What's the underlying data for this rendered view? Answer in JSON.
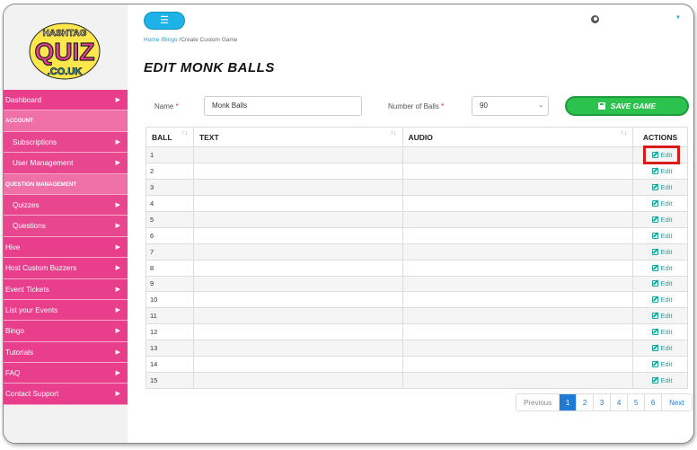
{
  "logo": {
    "line1": "HASHTAG",
    "line2": "QUIZ",
    "line3": ".CO.UK"
  },
  "sidebar": {
    "items": [
      {
        "label": "Dashboard",
        "kind": "top",
        "chevron": true
      },
      {
        "label": "ACCOUNT",
        "kind": "section",
        "chevron": false
      },
      {
        "label": "Subscriptions",
        "kind": "sub",
        "chevron": true
      },
      {
        "label": "User Management",
        "kind": "sub",
        "chevron": true
      },
      {
        "label": "QUESTION MANAGEMENT",
        "kind": "section",
        "chevron": false
      },
      {
        "label": "Quizzes",
        "kind": "sub",
        "chevron": true
      },
      {
        "label": "Questions",
        "kind": "sub",
        "chevron": true
      },
      {
        "label": "Hive",
        "kind": "top",
        "chevron": true
      },
      {
        "label": "Host Custom Buzzers",
        "kind": "top",
        "chevron": true
      },
      {
        "label": "Event Tickets",
        "kind": "top",
        "chevron": true
      },
      {
        "label": "List your Events",
        "kind": "top",
        "chevron": true
      },
      {
        "label": "Bingo",
        "kind": "top",
        "chevron": true
      },
      {
        "label": "Tutorials",
        "kind": "top",
        "chevron": true
      },
      {
        "label": "FAQ",
        "kind": "top",
        "chevron": true
      },
      {
        "label": "Contact Support",
        "kind": "top",
        "chevron": true
      }
    ]
  },
  "header": {
    "menu_icon": "hamburger-icon",
    "breadcrumb": {
      "home": "Home",
      "sep1": " /",
      "bingo": "Bingo",
      "current": " /Create Custom Game"
    },
    "page_title": "EDIT MONK BALLS"
  },
  "form": {
    "name_label": "Name",
    "name_value": "Monk Balls",
    "balls_label": "Number of Balls",
    "balls_value": "90",
    "required_mark": "*",
    "save_label": "SAVE GAME"
  },
  "table": {
    "headers": [
      "BALL",
      "TEXT",
      "AUDIO",
      "ACTIONS"
    ],
    "rows": [
      {
        "ball": "1",
        "text": "",
        "audio": "",
        "action": "Edit"
      },
      {
        "ball": "2",
        "text": "",
        "audio": "",
        "action": "Edit"
      },
      {
        "ball": "3",
        "text": "",
        "audio": "",
        "action": "Edit"
      },
      {
        "ball": "4",
        "text": "",
        "audio": "",
        "action": "Edit"
      },
      {
        "ball": "5",
        "text": "",
        "audio": "",
        "action": "Edit"
      },
      {
        "ball": "6",
        "text": "",
        "audio": "",
        "action": "Edit"
      },
      {
        "ball": "7",
        "text": "",
        "audio": "",
        "action": "Edit"
      },
      {
        "ball": "8",
        "text": "",
        "audio": "",
        "action": "Edit"
      },
      {
        "ball": "9",
        "text": "",
        "audio": "",
        "action": "Edit"
      },
      {
        "ball": "10",
        "text": "",
        "audio": "",
        "action": "Edit"
      },
      {
        "ball": "11",
        "text": "",
        "audio": "",
        "action": "Edit"
      },
      {
        "ball": "12",
        "text": "",
        "audio": "",
        "action": "Edit"
      },
      {
        "ball": "13",
        "text": "",
        "audio": "",
        "action": "Edit"
      },
      {
        "ball": "14",
        "text": "",
        "audio": "",
        "action": "Edit"
      },
      {
        "ball": "15",
        "text": "",
        "audio": "",
        "action": "Edit"
      }
    ]
  },
  "pagination": {
    "previous": "Previous",
    "pages": [
      "1",
      "2",
      "3",
      "4",
      "5",
      "6"
    ],
    "active_page": "1",
    "next": "Next"
  },
  "colors": {
    "sidebar_pink": "#e83e8c",
    "accent_blue": "#1eb3e6",
    "save_green": "#2cc24e",
    "edit_teal": "#16a79d",
    "highlight_red": "#d81a1a"
  }
}
